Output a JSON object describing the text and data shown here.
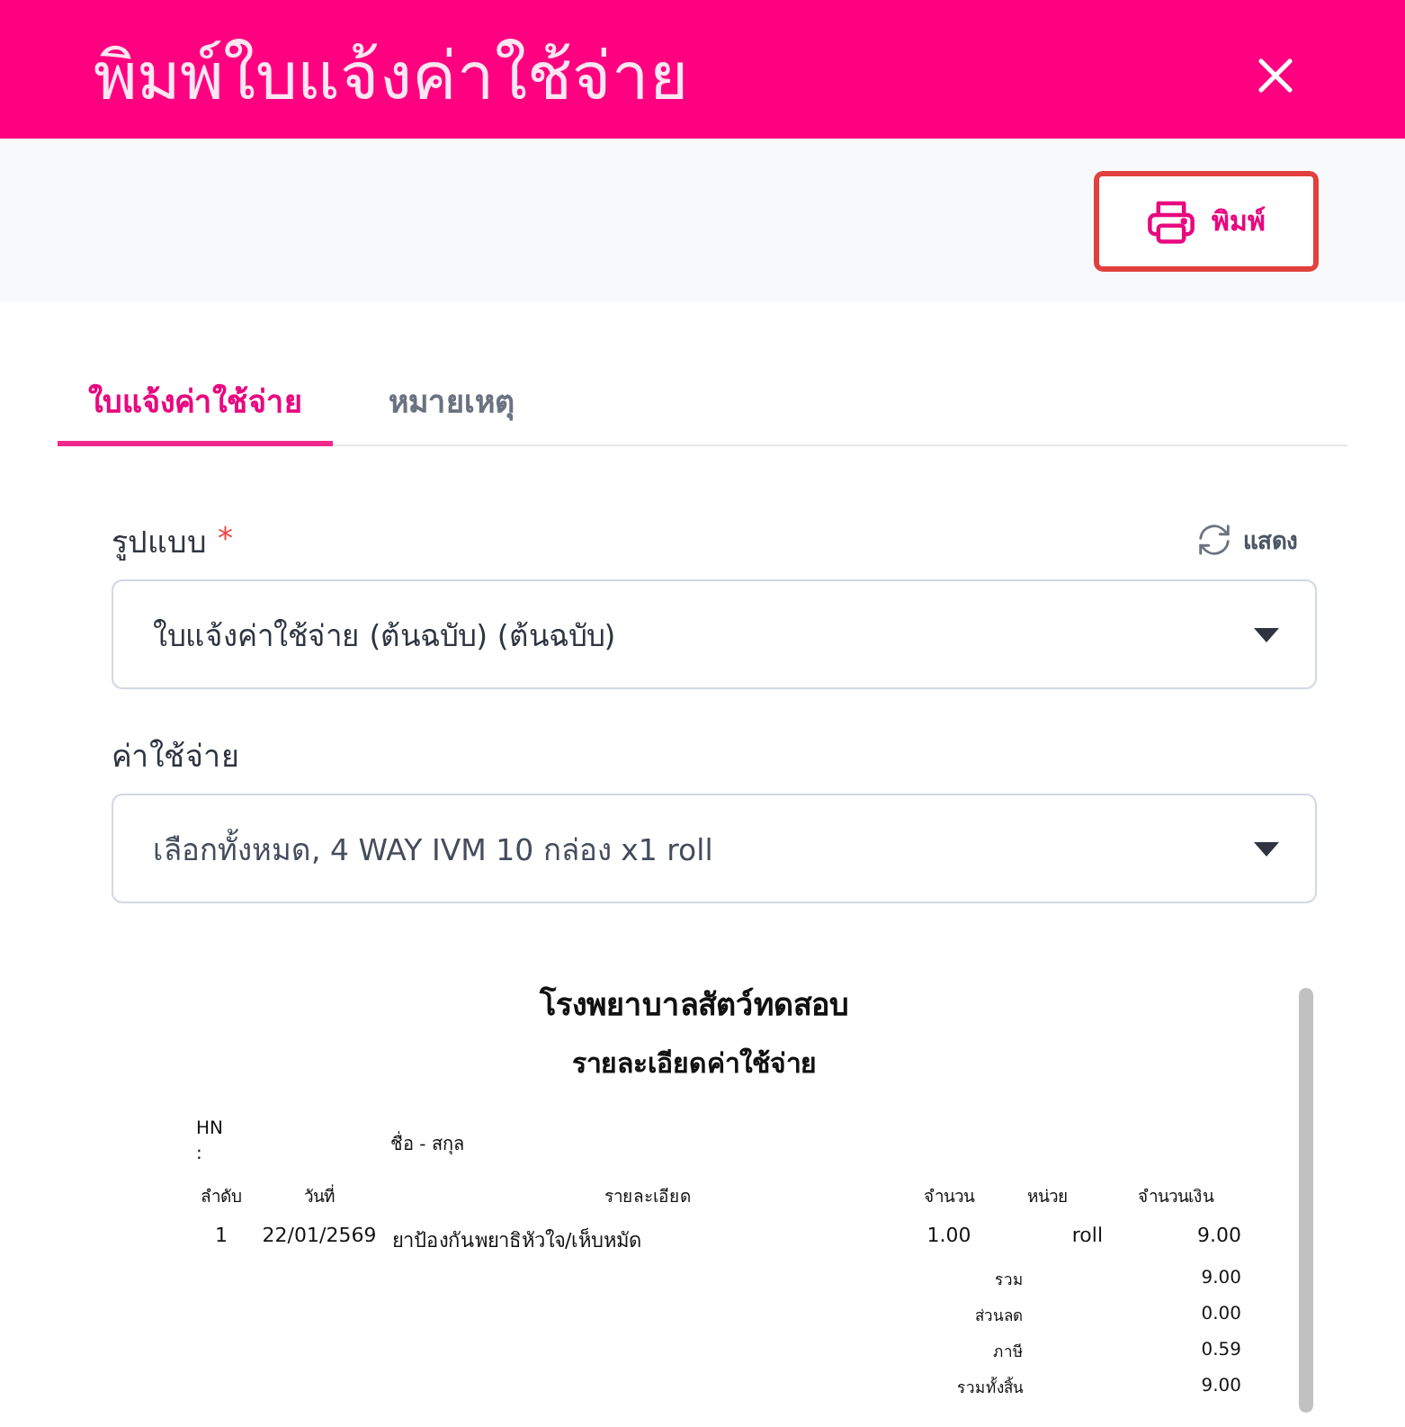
{
  "dialog": {
    "title": "พิมพ์ใบแจ้งค่าใช้จ่าย"
  },
  "toolbar": {
    "print_label": "พิมพ์"
  },
  "tabs": [
    {
      "label": "ใบแจ้งค่าใช้จ่าย",
      "selected": true
    },
    {
      "label": "หมายเหตุ",
      "selected": false
    }
  ],
  "form": {
    "fields": [
      {
        "label": "รูปแบบ",
        "required_mark": "*",
        "action": "แสดง",
        "value": "ใบแจ้งค่าใช้จ่าย (ต้นฉบับ) (ต้นฉบับ)"
      },
      {
        "label": "ค่าใช้จ่าย",
        "value": "เลือกทั้งหมด, 4 WAY IVM 10 กล่อง x1 roll"
      }
    ]
  },
  "preview": {
    "title": "โรงพยาบาลสัตว์ทดสอบ",
    "subtitle": "รายละเอียดค่าใช้จ่าย",
    "hn_label": "HN :",
    "name_label": "ชื่อ - สกุล",
    "columns": [
      "ลำดับ",
      "วันที่",
      "รายละเอียด",
      "จำนวน",
      "หน่วย",
      "จำนวนเงิน"
    ],
    "rows": [
      [
        "1",
        "22/01/2569",
        "ยาป้องกันพยาธิหัวใจ/เห็บหมัด",
        "1.00",
        "roll",
        "9.00"
      ]
    ],
    "totals": [
      {
        "label": "รวม",
        "value": "9.00"
      },
      {
        "label": "ส่วนลด",
        "value": "0.00"
      },
      {
        "label": "ภาษี",
        "value": "0.59"
      },
      {
        "label": "รวมทั้งสิ้น",
        "value": "9.00"
      }
    ]
  }
}
